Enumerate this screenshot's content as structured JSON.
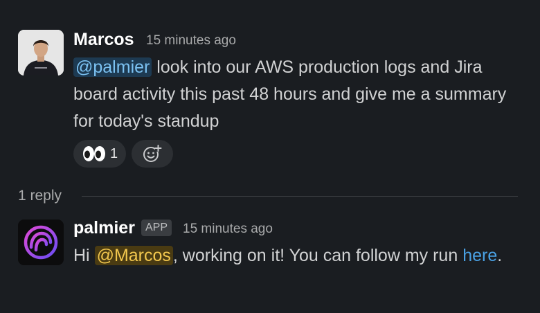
{
  "messages": [
    {
      "author": "Marcos",
      "timestamp": "15 minutes ago",
      "mention": "@palmier",
      "text": " look into our AWS production logs and Jira board activity this past 48 hours and give me a summary for today's standup",
      "reactions": [
        {
          "emoji": "eyes",
          "icon": "eyes-emoji",
          "count": "1"
        },
        {
          "icon": "add-reaction-icon"
        }
      ]
    },
    {
      "author": "palmier",
      "badge": "APP",
      "timestamp": "15 minutes ago",
      "text_before": "Hi ",
      "mention": "@Marcos",
      "text_middle": ", working on it! You can follow my run ",
      "link": "here",
      "text_after": "."
    }
  ],
  "thread": {
    "reply_count": "1 reply"
  },
  "colors": {
    "background": "#1a1d21",
    "mention_blue_bg": "#1d3a52",
    "mention_blue_fg": "#7cc2f2",
    "mention_gold_bg": "#4a3b12",
    "mention_gold_fg": "#f2c74e",
    "link": "#4aa1e4",
    "logo_gradient_start": "#e04ad6",
    "logo_gradient_end": "#6a4df5"
  }
}
